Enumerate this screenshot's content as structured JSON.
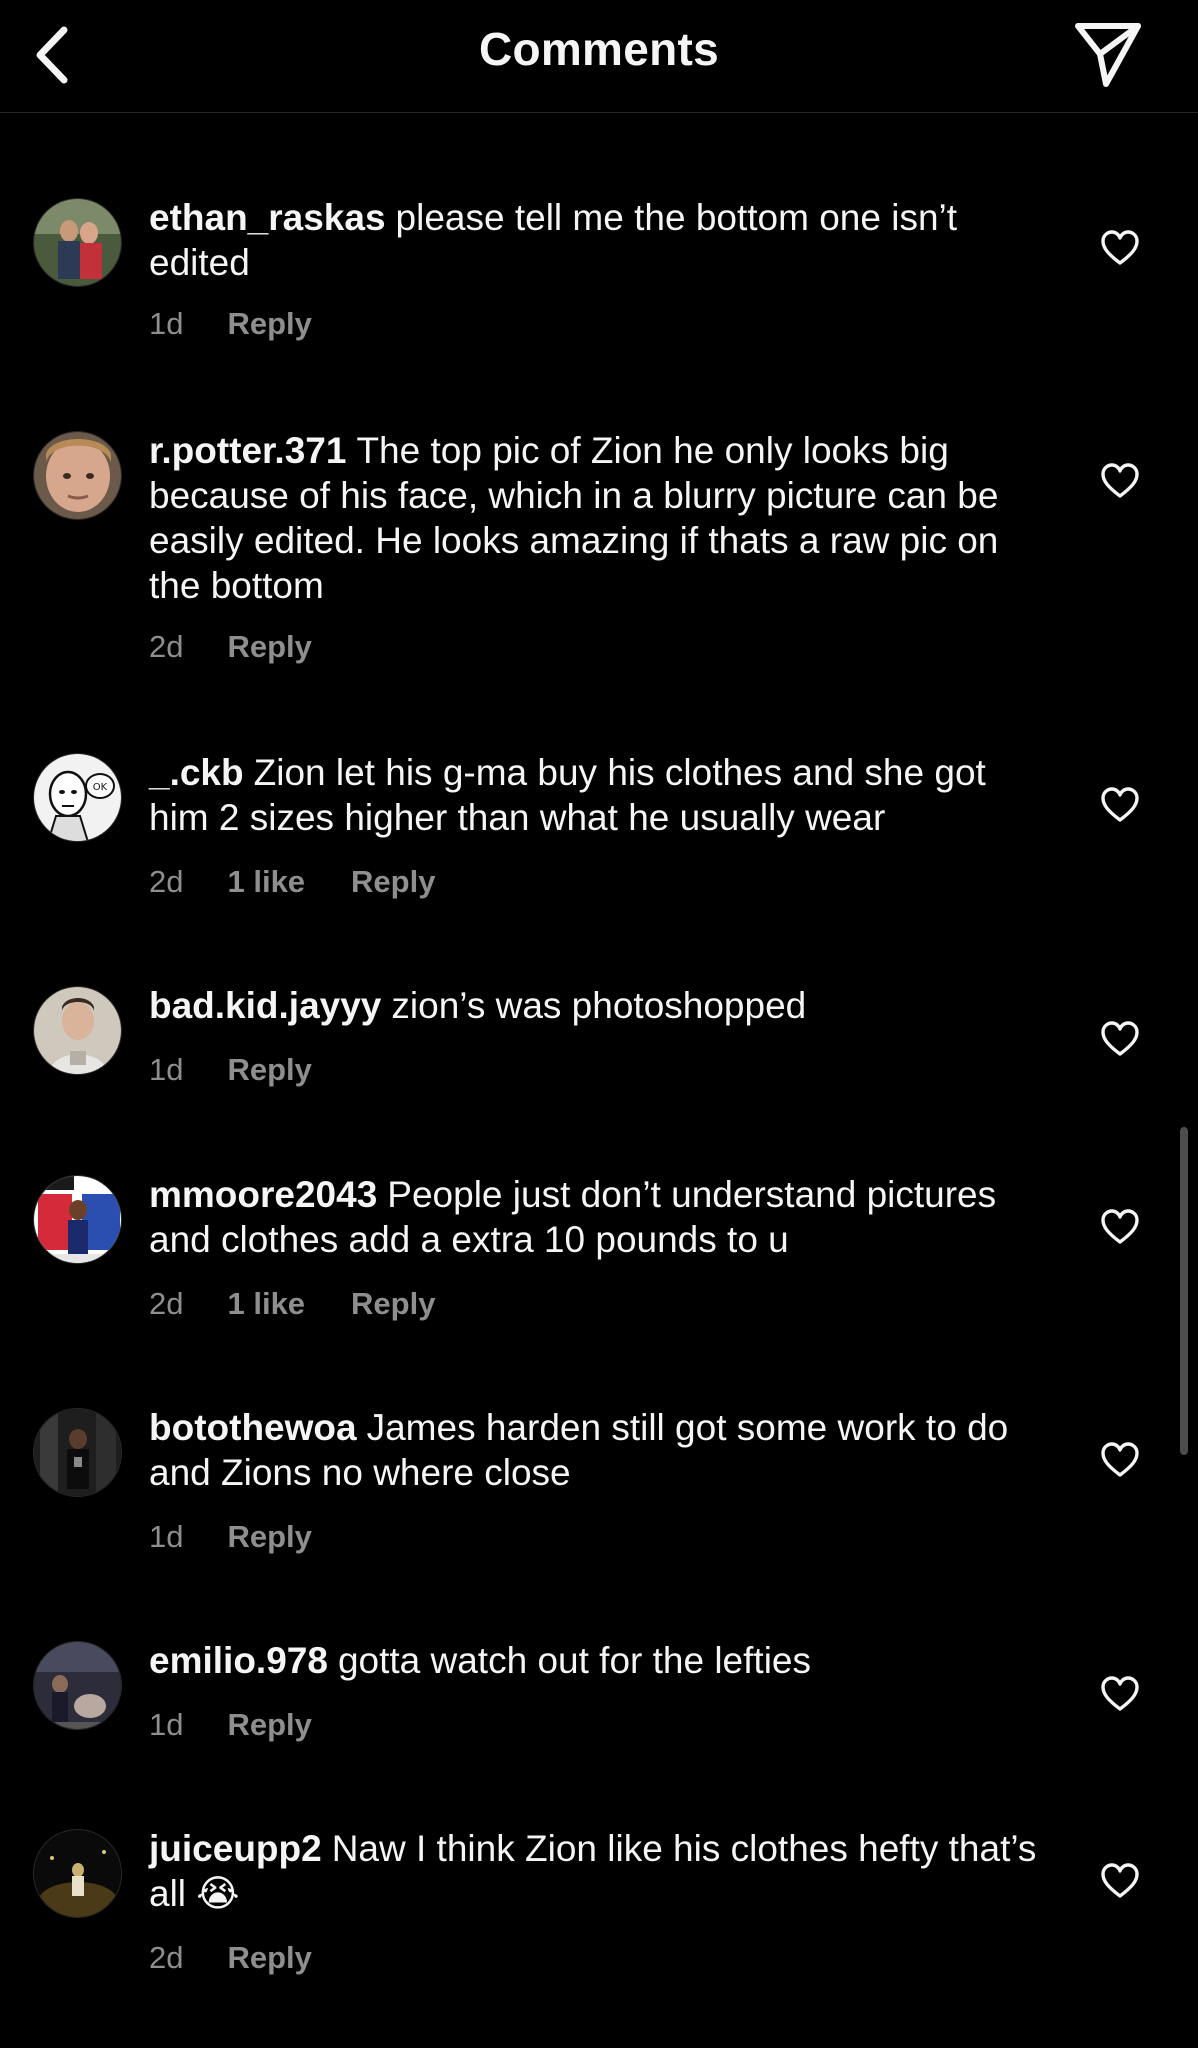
{
  "header": {
    "title": "Comments",
    "back_icon": "chevron-left-icon",
    "share_icon": "paper-plane-icon"
  },
  "theme": {
    "background": "#000000",
    "text": "#f5f5f5",
    "secondary": "#8e8e8e"
  },
  "comments": [
    {
      "username": "ethan_raskas",
      "text": "please tell me the bottom one isn’t edited",
      "time": "1d",
      "likes": "",
      "reply": "Reply"
    },
    {
      "username": "r.potter.371",
      "text": "The top pic of Zion he only looks big because of his face, which in a blurry picture can be easily edited. He looks amazing if thats a raw pic on the bottom",
      "time": "2d",
      "likes": "",
      "reply": "Reply"
    },
    {
      "username": "_.ckb",
      "text": "Zion let his g-ma buy his clothes and she got him 2 sizes higher than what he usually wear",
      "time": "2d",
      "likes": "1 like",
      "reply": "Reply"
    },
    {
      "username": "bad.kid.jayyy",
      "text": "zion’s was photoshopped",
      "time": "1d",
      "likes": "",
      "reply": "Reply"
    },
    {
      "username": "mmoore2043",
      "text": "People just don’t understand pictures and clothes add a extra 10 pounds to u",
      "time": "2d",
      "likes": "1 like",
      "reply": "Reply"
    },
    {
      "username": "botothewoa",
      "text": "James harden still got some work to do and Zions no where close",
      "time": "1d",
      "likes": "",
      "reply": "Reply"
    },
    {
      "username": "emilio.978",
      "text": "gotta watch out for the lefties",
      "time": "1d",
      "likes": "",
      "reply": "Reply"
    },
    {
      "username": "juiceupp2",
      "text": "Naw I think Zion like his clothes hefty that’s all 😭",
      "time": "2d",
      "likes": "",
      "reply": "Reply"
    }
  ]
}
